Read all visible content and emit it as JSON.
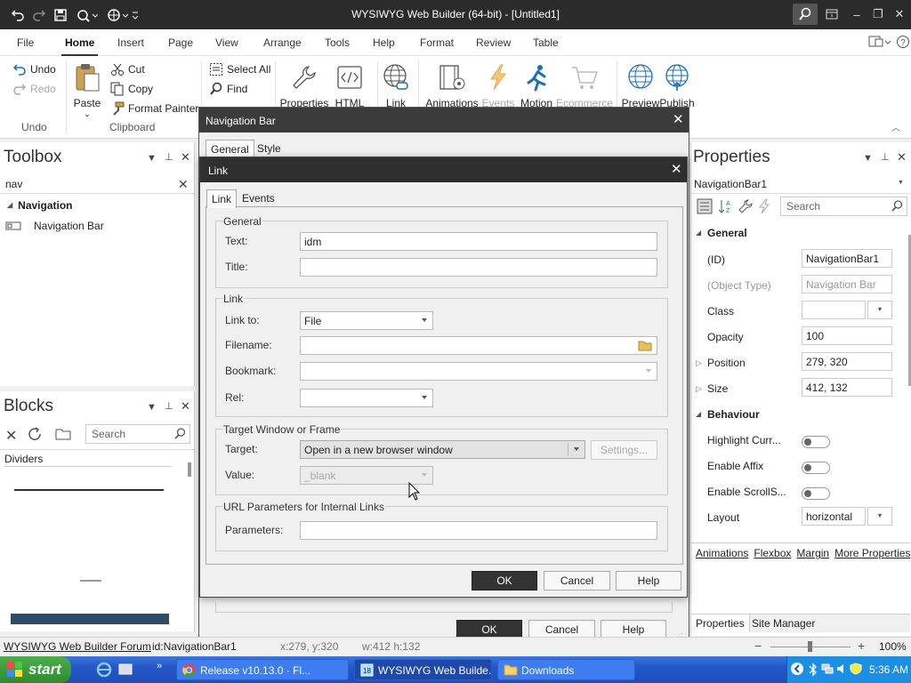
{
  "titlebar": {
    "title": "WYSIWYG Web Builder (64-bit) - [Untitled1]",
    "quick_access_icons": [
      "undo-icon",
      "redo-icon",
      "save-icon",
      "preview-icon",
      "publish-icon",
      "customize-icon"
    ]
  },
  "menu": {
    "tabs": [
      "File",
      "Home",
      "Insert",
      "Page",
      "View",
      "Arrange",
      "Tools",
      "Help",
      "Format",
      "Review",
      "Table"
    ],
    "active": "Home"
  },
  "ribbon": {
    "undo": {
      "undo": "Undo",
      "redo": "Redo",
      "group": "Undo"
    },
    "clipboard": {
      "paste": "Paste",
      "cut": "Cut",
      "copy": "Copy",
      "format_painter": "Format Painter",
      "group": "Clipboard"
    },
    "edit": {
      "select_all": "Select All",
      "find": "Find"
    },
    "tools": {
      "properties": "Properties",
      "html": "HTML",
      "link": "Link",
      "animations": "Animations",
      "events": "Events",
      "motion": "Motion",
      "ecommerce": "Ecommerce",
      "preview": "Preview",
      "publish": "Publish"
    }
  },
  "toolbox": {
    "title": "Toolbox",
    "search_value": "nav",
    "category": "Navigation",
    "item": "Navigation Bar"
  },
  "blocks": {
    "title": "Blocks",
    "search_placeholder": "Search",
    "category": "Dividers"
  },
  "properties": {
    "title": "Properties",
    "object": "NavigationBar1",
    "search_placeholder": "Search",
    "general_label": "General",
    "rows": [
      {
        "label": "(ID)",
        "value": "NavigationBar1"
      },
      {
        "label": "(Object Type)",
        "value": "Navigation Bar"
      },
      {
        "label": "Class",
        "value": ""
      },
      {
        "label": "Opacity",
        "value": "100"
      },
      {
        "label": "Position",
        "value": "279, 320"
      },
      {
        "label": "Size",
        "value": "412, 132"
      }
    ],
    "behaviour_label": "Behaviour",
    "toggles": [
      "Highlight Curr...",
      "Enable Affix",
      "Enable ScrollS..."
    ],
    "layout_label": "Layout",
    "layout_value": "horizontal",
    "links": [
      "Animations",
      "Flexbox",
      "Margin",
      "More Properties"
    ],
    "bottom_tabs": [
      "Properties",
      "Site Manager"
    ]
  },
  "nav_dialog": {
    "title": "Navigation Bar",
    "tabs": [
      "General",
      "Style"
    ],
    "ok": "OK",
    "cancel": "Cancel",
    "help": "Help"
  },
  "link_dialog": {
    "title": "Link",
    "tabs": [
      "Link",
      "Events"
    ],
    "general": {
      "legend": "General",
      "text_label": "Text:",
      "text_value": "idm",
      "title_label": "Title:",
      "title_value": ""
    },
    "link": {
      "legend": "Link",
      "link_to_label": "Link to:",
      "link_to_value": "File",
      "filename_label": "Filename:",
      "bookmark_label": "Bookmark:",
      "rel_label": "Rel:"
    },
    "target": {
      "legend": "Target Window or Frame",
      "target_label": "Target:",
      "target_value": "Open in a new browser window",
      "settings": "Settings...",
      "value_label": "Value:",
      "value_value": "_blank"
    },
    "url": {
      "legend": "URL Parameters for Internal Links",
      "params_label": "Parameters:"
    },
    "ok": "OK",
    "cancel": "Cancel",
    "help": "Help"
  },
  "statusbar": {
    "forum": "WYSIWYG Web Builder Forum",
    "id": "id:NavigationBar1",
    "pos": "x:279, y:320",
    "size": "w:412 h:132",
    "zoom": "100%"
  },
  "taskbar": {
    "start": "start",
    "tasks": [
      "Release v10.13.0 · Fl...",
      "WYSIWYG Web Builde...",
      "Downloads"
    ],
    "time": "5:36 AM"
  }
}
